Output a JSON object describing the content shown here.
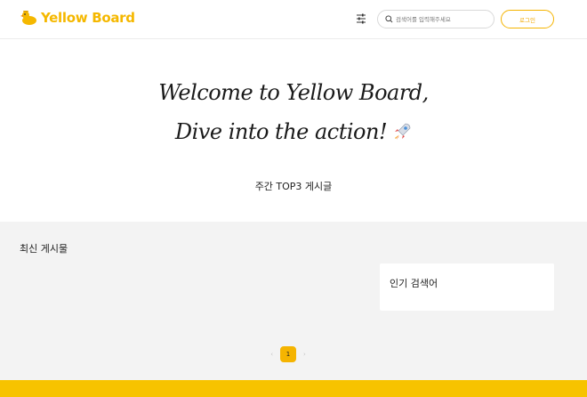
{
  "header": {
    "brand": "Yellow Board",
    "search_placeholder": "검색어를 입력해주세요",
    "login_label": "로그인"
  },
  "hero": {
    "line1": "Welcome to Yellow Board,",
    "line2": "Dive into the action!"
  },
  "weekly": {
    "title": "주간 TOP3 게시글"
  },
  "latest": {
    "title": "최신 게시물"
  },
  "popular": {
    "title": "인기 검색어"
  },
  "pagination": {
    "prev": "‹",
    "current": "1",
    "next": "›"
  },
  "colors": {
    "brand_yellow": "#f5b800",
    "footer_yellow": "#f7c300",
    "section_gray": "#f3f3f3"
  },
  "icons": [
    "duck-logo-icon",
    "filter-icon",
    "search-icon",
    "rocket-icon"
  ]
}
